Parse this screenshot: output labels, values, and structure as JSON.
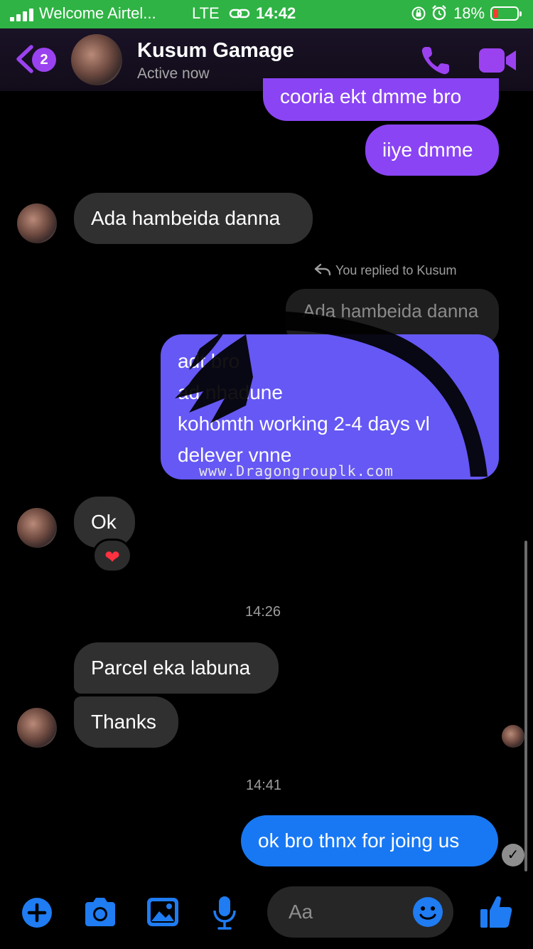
{
  "status_bar": {
    "carrier": "Welcome Airtel...",
    "network": "LTE",
    "time": "14:42",
    "battery_percent": "18%",
    "battery_level": 0.18,
    "signal_bars": 4
  },
  "header": {
    "back_badge": "2",
    "contact_name": "Kusum Gamage",
    "contact_status": "Active now",
    "accent_color": "#9b42f0"
  },
  "messages": {
    "m1": "cooria ekt dmme bro",
    "m2": "iiye dmme",
    "m3": "Ada hambeida danna",
    "reply_note": "You replied to Kusum",
    "quoted": "Ada hambeida danna",
    "reply_lines": [
      "adt      bro",
      "ad nhadune",
      "kohomth working 2-4 days vl",
      "delever vnne"
    ],
    "watermark": "www.Dragongrouplk.com",
    "m5": "Ok",
    "reaction": "❤",
    "time_1": "14:26",
    "m6": "Parcel eka labuna",
    "m7": "Thanks",
    "time_2": "14:41",
    "m8": "ok bro thnx for joing us"
  },
  "composer": {
    "placeholder": "Aa"
  },
  "colors": {
    "outgoing_purple": "#8a44f4",
    "outgoing_blue": "#1878f3",
    "reply_bubble": "#6558f5",
    "incoming": "#303030",
    "composer_icons": "#1f7cf2"
  },
  "icons": [
    "back-chevron",
    "phone",
    "video-camera",
    "reply-arrow",
    "heart",
    "check",
    "plus",
    "camera",
    "image",
    "microphone",
    "smiley",
    "thumbs-up"
  ]
}
